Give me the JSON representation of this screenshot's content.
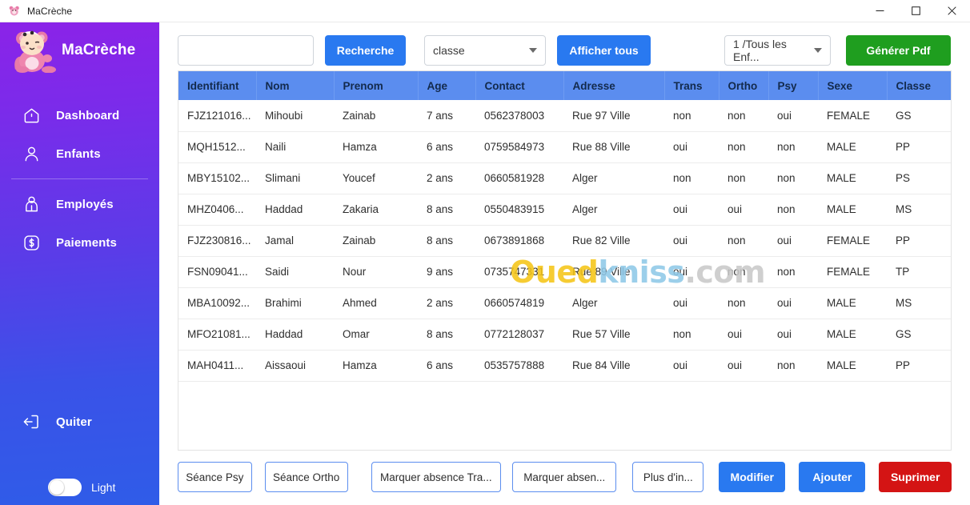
{
  "window": {
    "title": "MaCrèche",
    "icon": "app-bear-icon",
    "controls": {
      "minimize": "—",
      "maximize": "□",
      "close": "✕"
    }
  },
  "sidebar": {
    "brand": {
      "name": "MaCrèche",
      "logo_icon": "bear-logo-icon"
    },
    "items": [
      {
        "label": "Dashboard",
        "icon": "home-icon"
      },
      {
        "label": "Enfants",
        "icon": "person-icon"
      },
      {
        "label": "Employés",
        "icon": "employee-icon"
      },
      {
        "label": "Paiements",
        "icon": "dollar-square-icon"
      }
    ],
    "quit": {
      "label": "Quiter",
      "icon": "logout-icon"
    },
    "theme_toggle": {
      "label": "Light",
      "state": "off"
    },
    "colors": {
      "gradient_top": "#8b23e8",
      "gradient_bottom": "#2f5ce8"
    }
  },
  "toolbar": {
    "search": {
      "value": "",
      "placeholder": ""
    },
    "search_button": "Recherche",
    "class_select": {
      "value": "classe",
      "icon": "chevron-down-icon"
    },
    "show_all_button": "Afficher tous",
    "scope_select": {
      "value": "1 /Tous les Enf...",
      "icon": "chevron-down-icon"
    },
    "pdf_button": "Générer Pdf",
    "colors": {
      "primary": "#2979f0",
      "success": "#1f9e1f"
    }
  },
  "table": {
    "headers": [
      "Identifiant",
      "Nom",
      "Prenom",
      "Age",
      "Contact",
      "Adresse",
      "Trans",
      "Ortho",
      "Psy",
      "Sexe",
      "Classe"
    ],
    "header_bg": "#5b8def",
    "rows": [
      [
        "FJZ121016...",
        "Mihoubi",
        "Zainab",
        "7 ans",
        "0562378003",
        "Rue 97 Ville",
        "non",
        "non",
        "oui",
        "FEMALE",
        "GS"
      ],
      [
        "MQH1512...",
        "Naili",
        "Hamza",
        "6 ans",
        "0759584973",
        "Rue 88 Ville",
        "oui",
        "non",
        "non",
        "MALE",
        "PP"
      ],
      [
        "MBY15102...",
        "Slimani",
        "Youcef",
        "2 ans",
        "0660581928",
        "Alger",
        "non",
        "non",
        "non",
        "MALE",
        "PS"
      ],
      [
        "MHZ0406...",
        "Haddad",
        "Zakaria",
        "8 ans",
        "0550483915",
        "Alger",
        "oui",
        "oui",
        "non",
        "MALE",
        "MS"
      ],
      [
        "FJZ230816...",
        "Jamal",
        "Zainab",
        "8 ans",
        "0673891868",
        "Rue 82 Ville",
        "oui",
        "non",
        "oui",
        "FEMALE",
        "PP"
      ],
      [
        "FSN09041...",
        "Saidi",
        "Nour",
        "9 ans",
        "0735747331",
        "Rue 89 Ville",
        "oui",
        "non",
        "non",
        "FEMALE",
        "TP"
      ],
      [
        "MBA10092...",
        "Brahimi",
        "Ahmed",
        "2 ans",
        "0660574819",
        "Alger",
        "oui",
        "non",
        "oui",
        "MALE",
        "MS"
      ],
      [
        "MFO21081...",
        "Haddad",
        "Omar",
        "8 ans",
        "0772128037",
        "Rue 57 Ville",
        "non",
        "oui",
        "oui",
        "MALE",
        "GS"
      ],
      [
        "MAH0411...",
        "Aissaoui",
        "Hamza",
        "6 ans",
        "0535757888",
        "Rue 84 Ville",
        "oui",
        "oui",
        "non",
        "MALE",
        "PP"
      ]
    ]
  },
  "watermark": {
    "part1": "Oued",
    "part2": "kniss",
    "part3": ".com"
  },
  "actions": {
    "seance_psy": "Séance Psy",
    "seance_ortho": "Séance Ortho",
    "marquer_absence_trans": "Marquer absence Tra...",
    "marquer_absence": "Marquer absen...",
    "plus_infos": "Plus d'in...",
    "modifier": "Modifier",
    "ajouter": "Ajouter",
    "supprimer": "Suprimer",
    "colors": {
      "outline": "#5b8def",
      "primary": "#2979f0",
      "danger": "#d41414"
    }
  }
}
